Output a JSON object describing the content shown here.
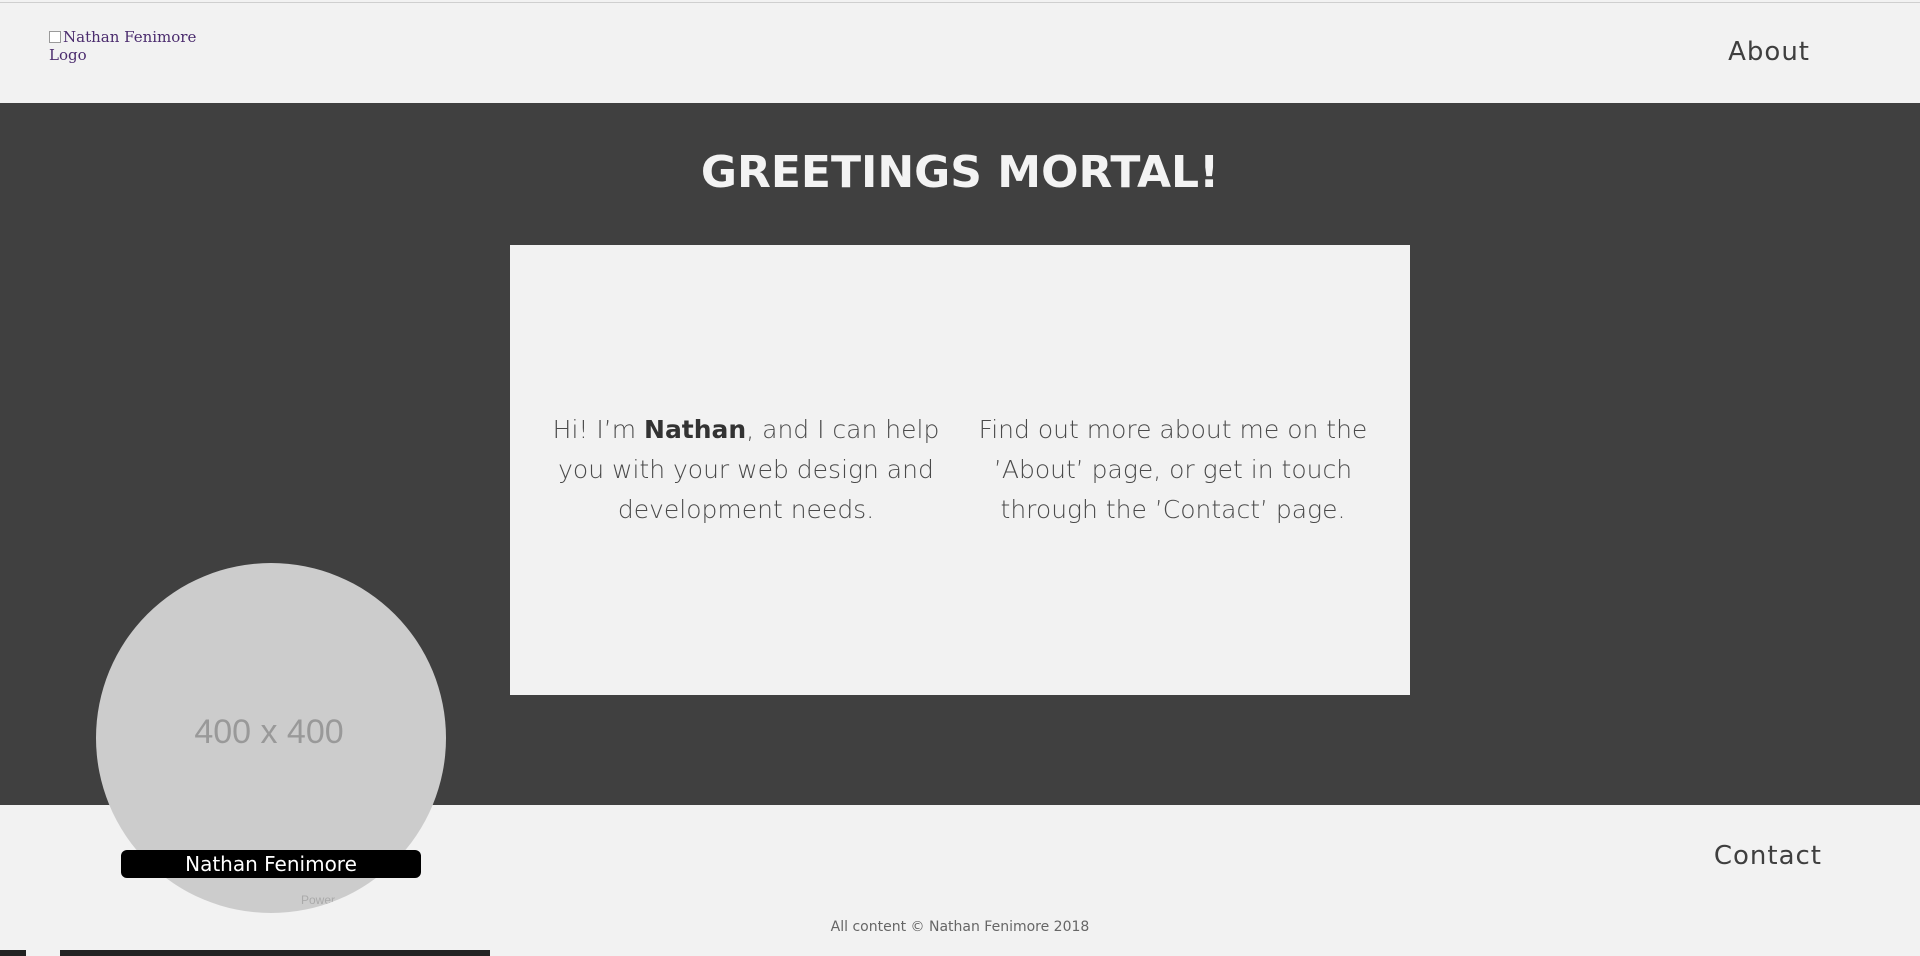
{
  "header": {
    "logo_alt": "Nathan Fenimore Logo",
    "nav_about": "About"
  },
  "main": {
    "headline": "GREETINGS MORTAL!",
    "intro_before": "Hi! I’m ",
    "intro_name": "Nathan",
    "intro_after": ", and I can help you with your web design and development needs.",
    "find_out": "Find out more about me on the ’About’ page, or get in touch through the ’Contact’ page."
  },
  "profile": {
    "placeholder": "400 x 400",
    "name": "Nathan Fenimore",
    "powered": "Power..."
  },
  "footer": {
    "nav_contact": "Contact",
    "copyright": "All content © Nathan Fenimore 2018"
  },
  "colors": {
    "dark_band": "#404040",
    "light_bg": "#f2f2f2",
    "name_tag_bg": "#000000"
  }
}
